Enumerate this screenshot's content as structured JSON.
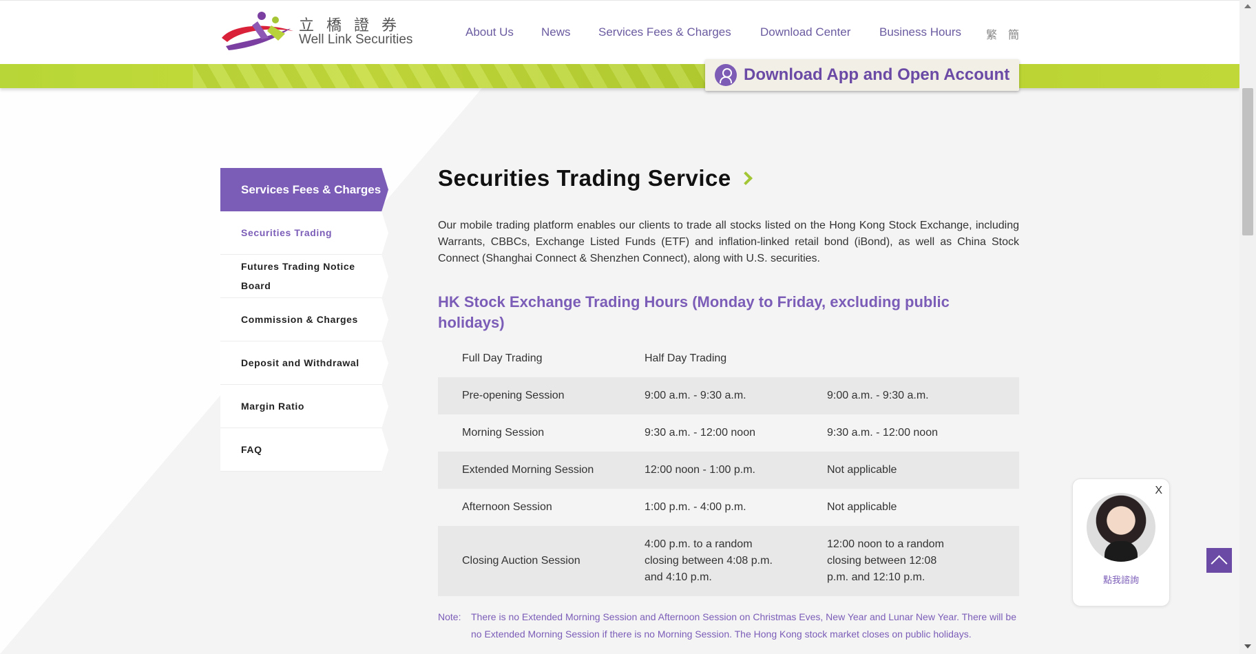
{
  "header": {
    "logo_cn": "立橋證券",
    "logo_en": "Well Link Securities",
    "nav": [
      {
        "label": "About Us"
      },
      {
        "label": "News"
      },
      {
        "label": "Services Fees & Charges"
      },
      {
        "label": "Download Center"
      },
      {
        "label": "Business Hours"
      }
    ],
    "lang_traditional": "繁",
    "lang_simplified": "簡",
    "download_label": "Download App and Open Account"
  },
  "sidebar": {
    "heading": "Services Fees & Charges",
    "items": [
      {
        "label": "Securities Trading",
        "active": true
      },
      {
        "label": "Futures Trading Notice Board",
        "active": false
      },
      {
        "label": "Commission & Charges",
        "active": false
      },
      {
        "label": "Deposit and Withdrawal",
        "active": false
      },
      {
        "label": "Margin Ratio",
        "active": false
      },
      {
        "label": "FAQ",
        "active": false
      }
    ]
  },
  "main": {
    "title": "Securities Trading Service",
    "intro": "Our mobile trading platform enables our clients to trade all stocks listed on the Hong Kong Stock Exchange, including Warrants, CBBCs, Exchange Listed Funds (ETF) and inflation-linked retail bond (iBond), as well as China Stock Connect (Shanghai Connect & Shenzhen Connect), along with U.S. securities.",
    "section_title": "HK Stock Exchange Trading Hours (Monday to Friday, excluding public holidays)",
    "table": {
      "headers": [
        "Full Day Trading",
        "Half Day Trading",
        ""
      ],
      "rows": [
        [
          "Pre-opening Session",
          "9:00 a.m. - 9:30 a.m.",
          "9:00 a.m. - 9:30 a.m."
        ],
        [
          "Morning Session",
          "9:30 a.m. - 12:00 noon",
          "9:30 a.m. - 12:00 noon"
        ],
        [
          "Extended Morning Session",
          "12:00 noon - 1:00 p.m.",
          "Not applicable"
        ],
        [
          "Afternoon Session",
          "1:00 p.m. - 4:00 p.m.",
          "Not applicable"
        ],
        [
          "Closing Auction Session",
          "4:00 p.m. to a random closing between 4:08 p.m. and 4:10 p.m.",
          "12:00 noon to a random closing between 12:08 p.m. and 12:10 p.m."
        ]
      ]
    },
    "note_label": "Note:",
    "note_text": "There is no Extended Morning Session and Afternoon Session on Christmas Eves, New Year and Lunar New Year. There will be no Extended Morning Session if there is no Morning Session. The Hong Kong stock market closes on public holidays."
  },
  "chat": {
    "close_label": "X",
    "label": "點我諮詢"
  },
  "colors": {
    "brand_purple": "#7b5db8",
    "brand_green": "#b8d637"
  }
}
